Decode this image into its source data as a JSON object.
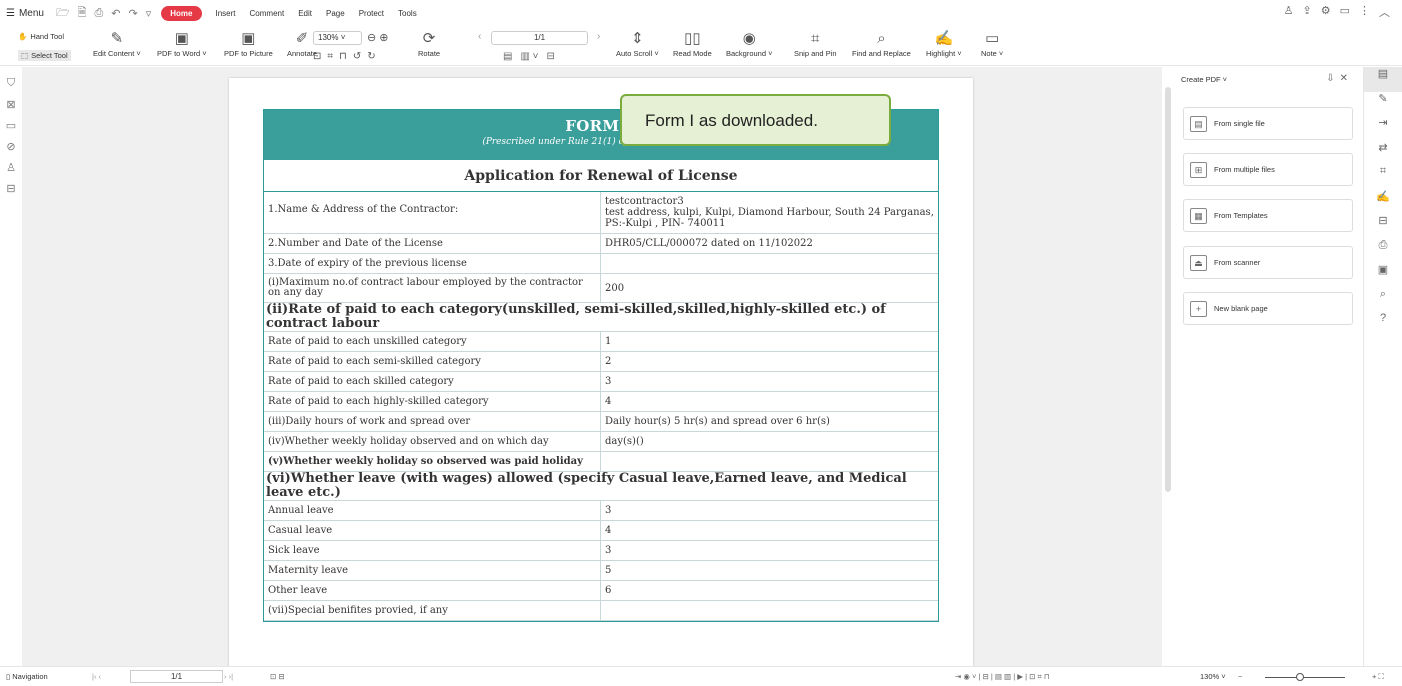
{
  "topbar": {
    "menu_label": "Menu",
    "tabs": [
      "Home",
      "Insert",
      "Comment",
      "Edit",
      "Page",
      "Protect",
      "Tools"
    ]
  },
  "ribbon": {
    "hand_tool": "Hand Tool",
    "select_tool": "Select Tool",
    "edit_content": "Edit Content ˅",
    "pdf_to_word": "PDF to Word ˅",
    "pdf_to_picture": "PDF to Picture",
    "annotate": "Annotate",
    "zoom": "130%",
    "rotate": "Rotate",
    "page_input": "1/1",
    "auto_scroll": "Auto Scroll ˅",
    "read_mode": "Read Mode",
    "background": "Background ˅",
    "snip_and_pin": "Snip and Pin",
    "find_replace": "Find and Replace",
    "highlight": "Highlight ˅",
    "note": "Note ˅"
  },
  "document": {
    "header_title": "FORM V",
    "header_subtitle": "(Prescribed under Rule 21(1) of the West Bengal Co",
    "form_title": "Application for Renewal of License",
    "rows_top": [
      {
        "label": "1.Name & Address of the Contractor:",
        "value": "testcontractor3\ntest address, kulpi, Kulpi, Diamond Harbour, South 24 Parganas, PS:-Kulpi , PIN- 740011"
      },
      {
        "label": "2.Number and Date of the License",
        "value": "DHR05/CLL/000072 dated on 11/102022"
      },
      {
        "label": "3.Date of expiry of the previous license",
        "value": ""
      },
      {
        "label": "(i)Maximum no.of contract labour employed by the contractor on any day",
        "value": "200"
      }
    ],
    "section_rates": "(ii)Rate of paid to each category(unskilled, semi-skilled,skilled,highly-skilled etc.) of contract labour",
    "rows_rates": [
      {
        "label": "Rate of paid to each unskilled category",
        "value": "1"
      },
      {
        "label": "Rate of paid to each semi-skilled category",
        "value": "2"
      },
      {
        "label": "Rate of paid to each skilled category",
        "value": "3"
      },
      {
        "label": "Rate of paid to each highly-skilled category",
        "value": "4"
      },
      {
        "label": "(iii)Daily hours of work and spread over",
        "value": "Daily hour(s) 5 hr(s) and spread over 6 hr(s)"
      },
      {
        "label": "(iv)Whether weekly holiday observed and on which day",
        "value": "day(s)()"
      }
    ],
    "row_holiday_paid": "(v)Whether weekly holiday so observed was paid holiday",
    "section_leave": "(vi)Whether leave (with wages) allowed (specify Casual leave,Earned leave, and Medical leave etc.)",
    "rows_leave": [
      {
        "label": "Annual leave",
        "value": "3"
      },
      {
        "label": "Casual leave",
        "value": "4"
      },
      {
        "label": "Sick leave",
        "value": "3"
      },
      {
        "label": "Maternity leave",
        "value": "5"
      },
      {
        "label": "Other leave",
        "value": "6"
      }
    ],
    "row_special": "(vii)Special benifites provied, if any"
  },
  "callout": "Form I as downloaded.",
  "panel": {
    "title": "Create PDF ˅",
    "buttons": [
      "From single file",
      "From multiple files",
      "From Templates",
      "From scanner",
      "New blank page"
    ]
  },
  "statusbar": {
    "navigation": "Navigation",
    "page": "1/1",
    "zoom": "130% ˅"
  }
}
